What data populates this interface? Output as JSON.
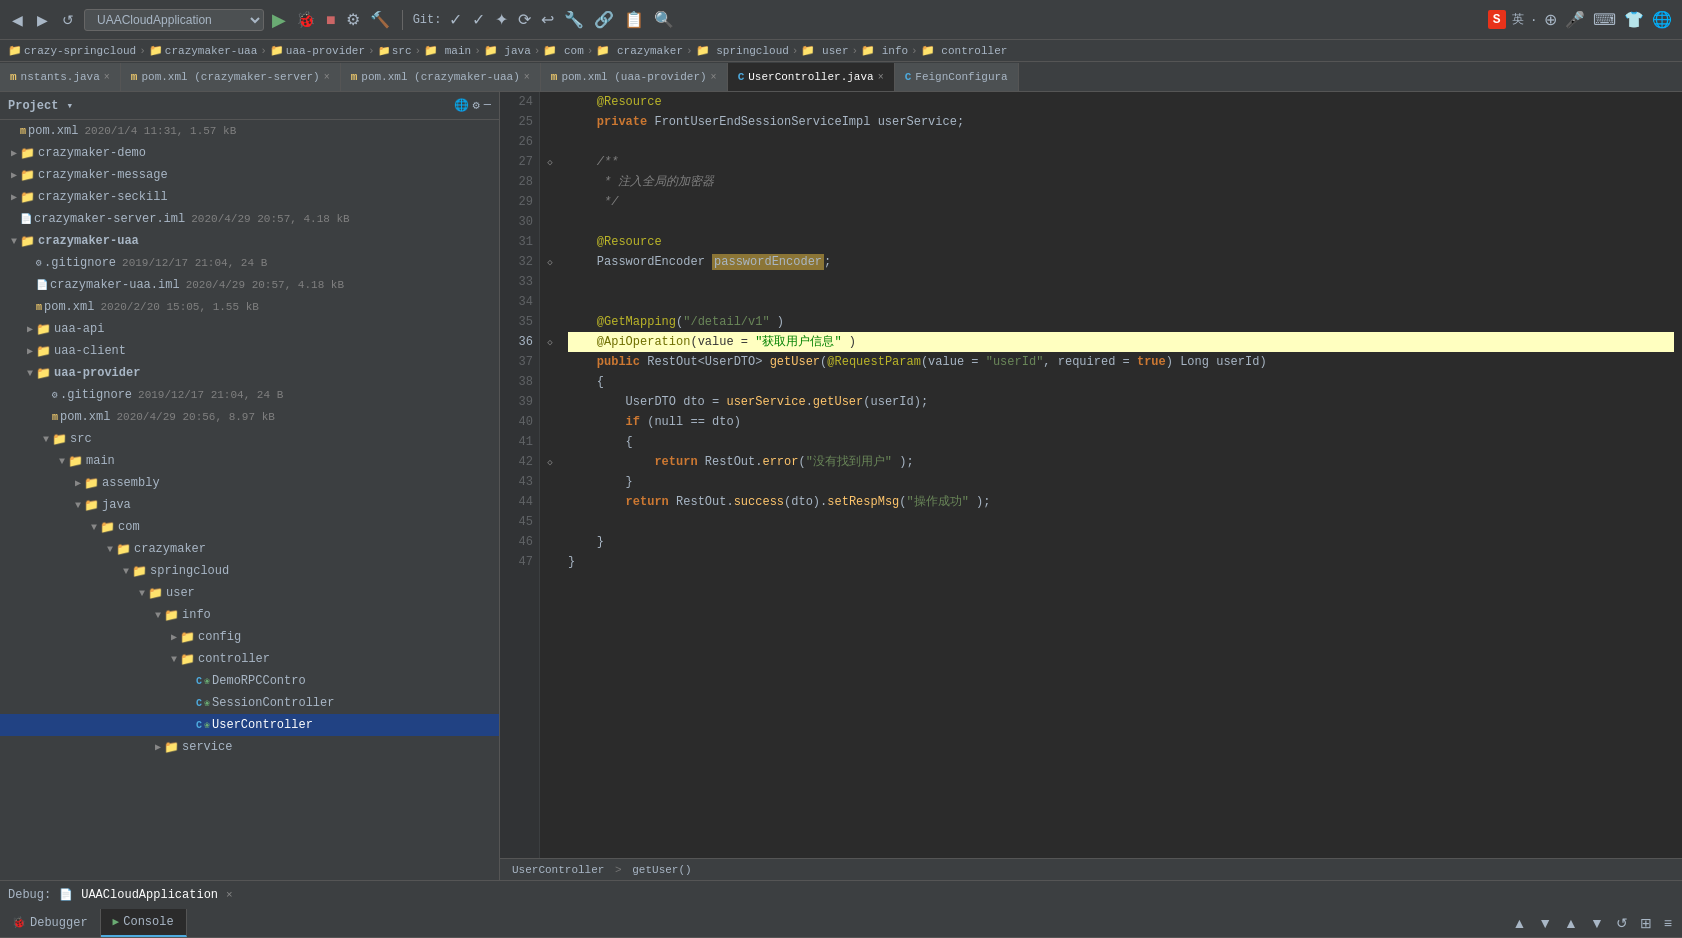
{
  "toolbar": {
    "back_btn": "◀",
    "forward_btn": "▶",
    "refresh_btn": "↺",
    "app_dropdown": "UAACloudApplication",
    "run_btn": "▶",
    "debug_btn": "🐞",
    "stop_btn": "■",
    "build_btns": [
      "⚙",
      "🔨"
    ],
    "git_label": "Git:",
    "git_icons": [
      "✓",
      "✓",
      "✦",
      "⟳",
      "↩",
      "🔧",
      "🔗",
      "📋",
      "🔍"
    ],
    "right_icons": [
      "S",
      "英",
      "·",
      "⊕",
      "🎤",
      "⌨",
      "👕",
      "🌐"
    ]
  },
  "breadcrumb": {
    "items": [
      "crazy-springcloud",
      "crazymaker-uaa",
      "uaa-provider",
      "src",
      "main",
      "java",
      "com",
      "crazymaker",
      "springcloud",
      "user",
      "info",
      "controller"
    ]
  },
  "tabs": [
    {
      "id": "constants",
      "icon": "m",
      "label": "nstants.java",
      "active": false,
      "closable": true
    },
    {
      "id": "pom-server",
      "icon": "m",
      "label": "pom.xml (crazymaker-server)",
      "active": false,
      "closable": true
    },
    {
      "id": "pom-uaa",
      "icon": "m",
      "label": "pom.xml (crazymaker-uaa)",
      "active": false,
      "closable": true
    },
    {
      "id": "pom-provider",
      "icon": "m",
      "label": "pom.xml (uaa-provider)",
      "active": false,
      "closable": true
    },
    {
      "id": "user-controller",
      "icon": "c",
      "label": "UserController.java",
      "active": true,
      "closable": true
    },
    {
      "id": "feign-config",
      "icon": "c",
      "label": "FeignConfigura",
      "active": false,
      "closable": true
    }
  ],
  "project": {
    "title": "Project",
    "items": [
      {
        "id": "pom-root",
        "indent": 0,
        "type": "file-m",
        "icon": "m",
        "label": "pom.xml",
        "meta": "2020/1/4 11:31, 1.57 kB",
        "depth": 0
      },
      {
        "id": "crazymaker-demo",
        "indent": 1,
        "type": "folder",
        "label": "crazymaker-demo",
        "depth": 1,
        "expanded": false
      },
      {
        "id": "crazymaker-message",
        "indent": 1,
        "type": "folder",
        "label": "crazymaker-message",
        "depth": 1,
        "expanded": false
      },
      {
        "id": "crazymaker-seckill",
        "indent": 1,
        "type": "folder",
        "label": "crazymaker-seckill",
        "depth": 1,
        "expanded": false
      },
      {
        "id": "crazymaker-server.iml",
        "indent": 1,
        "type": "file-iml",
        "label": "crazymaker-server.iml",
        "meta": "2020/4/29 20:57, 4.18 kB",
        "depth": 1
      },
      {
        "id": "crazymaker-uaa",
        "indent": 1,
        "type": "folder",
        "label": "crazymaker-uaa",
        "depth": 1,
        "expanded": true
      },
      {
        "id": "gitignore-uaa",
        "indent": 2,
        "type": "file-git",
        "label": ".gitignore",
        "meta": "2019/12/17 21:04, 24 B",
        "depth": 2
      },
      {
        "id": "crazymaker-uaa.iml",
        "indent": 2,
        "type": "file-iml",
        "label": "crazymaker-uaa.iml",
        "meta": "2020/4/29 20:57, 4.18 kB",
        "depth": 2
      },
      {
        "id": "pom-uaa-file",
        "indent": 2,
        "type": "file-m",
        "icon": "m",
        "label": "pom.xml",
        "meta": "2020/2/20 15:05, 1.55 kB",
        "depth": 2
      },
      {
        "id": "uaa-api",
        "indent": 2,
        "type": "folder",
        "label": "uaa-api",
        "depth": 2,
        "expanded": false
      },
      {
        "id": "uaa-client",
        "indent": 2,
        "type": "folder",
        "label": "uaa-client",
        "depth": 2,
        "expanded": false
      },
      {
        "id": "uaa-provider",
        "indent": 2,
        "type": "folder",
        "label": "uaa-provider",
        "depth": 2,
        "expanded": true,
        "bold": true
      },
      {
        "id": "gitignore-provider",
        "indent": 3,
        "type": "file-git",
        "label": ".gitignore",
        "meta": "2019/12/17 21:04, 24 B",
        "depth": 3
      },
      {
        "id": "pom-provider-file",
        "indent": 3,
        "type": "file-m",
        "icon": "m",
        "label": "pom.xml",
        "meta": "2020/4/29 20:56, 8.97 kB",
        "depth": 3
      },
      {
        "id": "src-folder",
        "indent": 3,
        "type": "folder",
        "label": "src",
        "depth": 3,
        "expanded": true
      },
      {
        "id": "main-folder",
        "indent": 4,
        "type": "folder",
        "label": "main",
        "depth": 4,
        "expanded": true
      },
      {
        "id": "assembly-folder",
        "indent": 5,
        "type": "folder",
        "label": "assembly",
        "depth": 5,
        "expanded": false
      },
      {
        "id": "java-folder",
        "indent": 5,
        "type": "folder",
        "label": "java",
        "depth": 5,
        "expanded": true
      },
      {
        "id": "com-folder",
        "indent": 6,
        "type": "folder",
        "label": "com",
        "depth": 6,
        "expanded": true
      },
      {
        "id": "crazymaker-folder",
        "indent": 7,
        "type": "folder",
        "label": "crazymaker",
        "depth": 7,
        "expanded": true
      },
      {
        "id": "springcloud-folder",
        "indent": 8,
        "type": "folder",
        "label": "springcloud",
        "depth": 8,
        "expanded": true
      },
      {
        "id": "user-folder",
        "indent": 9,
        "type": "folder",
        "label": "user",
        "depth": 9,
        "expanded": true
      },
      {
        "id": "info-folder",
        "indent": 10,
        "type": "folder",
        "label": "info",
        "depth": 10,
        "expanded": true
      },
      {
        "id": "config-folder",
        "indent": 11,
        "type": "folder",
        "label": "config",
        "depth": 11,
        "expanded": false
      },
      {
        "id": "controller-folder",
        "indent": 11,
        "type": "folder",
        "label": "controller",
        "depth": 11,
        "expanded": true
      },
      {
        "id": "demo-rpc-ctrl",
        "indent": 12,
        "type": "file-c",
        "label": "DemoRPCContro",
        "depth": 12
      },
      {
        "id": "session-ctrl",
        "indent": 12,
        "type": "file-c",
        "label": "SessionController",
        "depth": 12
      },
      {
        "id": "user-ctrl",
        "indent": 12,
        "type": "file-c",
        "label": "UserController",
        "depth": 12,
        "selected": true
      },
      {
        "id": "service-folder",
        "indent": 10,
        "type": "folder",
        "label": "service",
        "depth": 10,
        "expanded": false
      }
    ]
  },
  "code": {
    "lines": [
      {
        "num": 24,
        "content": "    @Resource",
        "type": "annotation-line"
      },
      {
        "num": 25,
        "content": "    private FrontUserEndSessionServiceImpl userService;",
        "type": "normal"
      },
      {
        "num": 26,
        "content": "",
        "type": "normal"
      },
      {
        "num": 27,
        "content": "    /**",
        "type": "comment"
      },
      {
        "num": 28,
        "content": "     * 注入全局的加密器",
        "type": "comment"
      },
      {
        "num": 29,
        "content": "     */",
        "type": "comment"
      },
      {
        "num": 30,
        "content": "",
        "type": "normal"
      },
      {
        "num": 31,
        "content": "    @Resource",
        "type": "annotation-line"
      },
      {
        "num": 32,
        "content": "    PasswordEncoder passwordEncoder;",
        "type": "normal"
      },
      {
        "num": 33,
        "content": "",
        "type": "normal"
      },
      {
        "num": 34,
        "content": "",
        "type": "normal"
      },
      {
        "num": 35,
        "content": "    @GetMapping(\"/detail/v1\" )",
        "type": "annotation-line"
      },
      {
        "num": 36,
        "content": "    @ApiOperation(value = \"获取用户信息\" )",
        "type": "highlighted"
      },
      {
        "num": 37,
        "content": "    public RestOut<UserDTO> getUser(@RequestParam(value = \"userId\", required = true) Long userId)",
        "type": "normal"
      },
      {
        "num": 38,
        "content": "    {",
        "type": "normal"
      },
      {
        "num": 39,
        "content": "        UserDTO dto = userService.getUser(userId);",
        "type": "normal"
      },
      {
        "num": 40,
        "content": "        if (null == dto)",
        "type": "normal"
      },
      {
        "num": 41,
        "content": "        {",
        "type": "normal"
      },
      {
        "num": 42,
        "content": "            return RestOut.error(\"没有找到用户\" );",
        "type": "normal"
      },
      {
        "num": 43,
        "content": "        }",
        "type": "normal"
      },
      {
        "num": 44,
        "content": "        return RestOut.success(dto).setRespMsg(\"操作成功\" );",
        "type": "normal"
      },
      {
        "num": 45,
        "content": "",
        "type": "normal"
      },
      {
        "num": 46,
        "content": "    }",
        "type": "normal"
      },
      {
        "num": 47,
        "content": "}",
        "type": "normal"
      }
    ]
  },
  "status_breadcrumb": {
    "items": [
      "UserController",
      ">",
      "getUser()"
    ]
  },
  "debug": {
    "label": "Debug:",
    "app_name": "UAACloudApplication",
    "tabs": [
      "Debugger",
      "Console"
    ]
  },
  "bottom_tools": {
    "buttons": [
      "▲",
      "▼",
      "▲",
      "▼",
      "↺",
      "⊞",
      "≡"
    ]
  }
}
